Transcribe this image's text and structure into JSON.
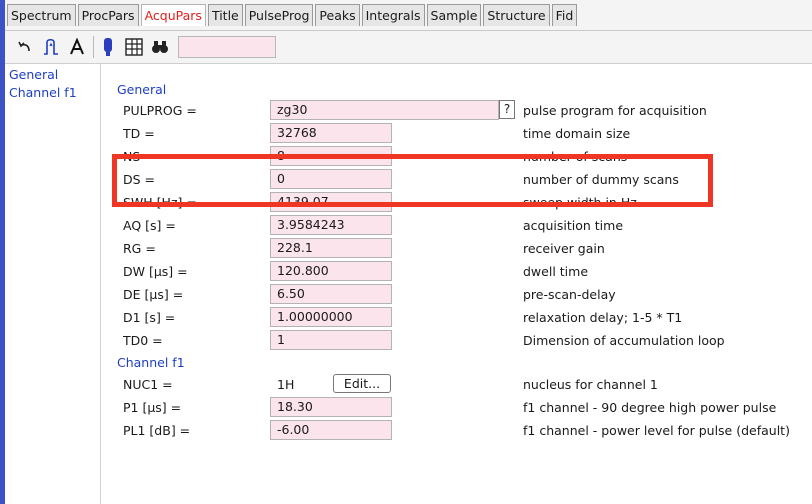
{
  "tabs": [
    {
      "label": "Spectrum",
      "active": false
    },
    {
      "label": "ProcPars",
      "active": false
    },
    {
      "label": "AcquPars",
      "active": true
    },
    {
      "label": "Title",
      "active": false
    },
    {
      "label": "PulseProg",
      "active": false
    },
    {
      "label": "Peaks",
      "active": false
    },
    {
      "label": "Integrals",
      "active": false
    },
    {
      "label": "Sample",
      "active": false
    },
    {
      "label": "Structure",
      "active": false
    },
    {
      "label": "Fid",
      "active": false
    }
  ],
  "toolbar": {
    "icons": [
      "undo-icon",
      "pulse-icon",
      "font-a-icon",
      "probe-icon",
      "table-icon",
      "binoculars-icon"
    ],
    "search_value": ""
  },
  "nav": {
    "items": [
      "General",
      "Channel f1"
    ]
  },
  "sections": {
    "general": "General",
    "channel_f1": "Channel f1"
  },
  "general_rows": [
    {
      "label": "PULPROG =",
      "value": "zg30",
      "desc": "pulse program for acquisition",
      "wide": true,
      "help": "?"
    },
    {
      "label": "TD =",
      "value": "32768",
      "desc": "time domain size"
    },
    {
      "label": "NS =",
      "value": "8",
      "desc": "number of scans"
    },
    {
      "label": "DS =",
      "value": "0",
      "desc": "number of dummy scans"
    },
    {
      "label": "SWH [Hz] =",
      "value": "4139.07",
      "desc": "sweep width in Hz"
    },
    {
      "label": "AQ [s] =",
      "value": "3.9584243",
      "desc": "acquisition time"
    },
    {
      "label": "RG =",
      "value": "228.1",
      "desc": "receiver gain"
    },
    {
      "label": "DW [µs] =",
      "value": "120.800",
      "desc": "dwell time"
    },
    {
      "label": "DE [µs] =",
      "value": "6.50",
      "desc": "pre-scan-delay"
    },
    {
      "label": "D1 [s] =",
      "value": "1.00000000",
      "desc": "relaxation delay; 1-5 * T1"
    },
    {
      "label": "TD0 =",
      "value": "1",
      "desc": "Dimension of accumulation loop"
    }
  ],
  "channel_rows": [
    {
      "label": "NUC1 =",
      "value": "1H",
      "desc": "nucleus for channel 1",
      "edit": "Edit..."
    },
    {
      "label": "P1 [µs] =",
      "value": "18.30",
      "desc": "f1 channel -  90 degree high power pulse"
    },
    {
      "label": "PL1 [dB] =",
      "value": "-6.00",
      "desc": "f1 channel - power level for pulse (default)"
    }
  ],
  "colors": {
    "accent_blue": "#1e3fc4",
    "field_pink": "#fce4ec",
    "highlight_red": "#ef3524",
    "active_tab_text": "#e0201a"
  }
}
